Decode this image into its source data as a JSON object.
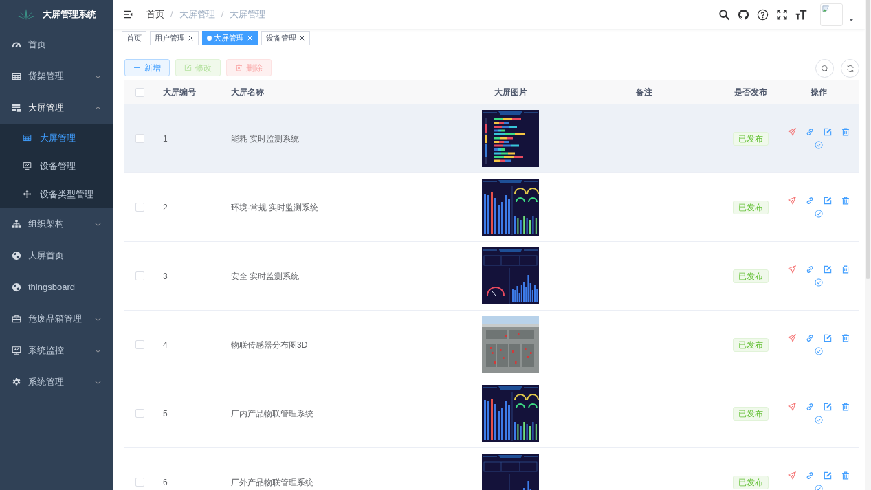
{
  "sidebar": {
    "title": "大屏管理系统",
    "items": [
      {
        "label": "首页",
        "kind": "link",
        "selected": false
      },
      {
        "label": "货架管理",
        "kind": "group",
        "selected": false,
        "expanded": false
      },
      {
        "label": "大屏管理",
        "kind": "group",
        "selected": true,
        "expanded": true,
        "children": [
          {
            "label": "大屏管理",
            "selected": true
          },
          {
            "label": "设备管理",
            "selected": false
          },
          {
            "label": "设备类型管理",
            "selected": false
          }
        ]
      },
      {
        "label": "组织架构",
        "kind": "group",
        "selected": false,
        "expanded": false
      },
      {
        "label": "大屏首页",
        "kind": "link",
        "selected": false
      },
      {
        "label": "thingsboard",
        "kind": "link",
        "selected": false
      },
      {
        "label": "危废品箱管理",
        "kind": "group",
        "selected": false,
        "expanded": false
      },
      {
        "label": "系统监控",
        "kind": "group",
        "selected": false,
        "expanded": false
      },
      {
        "label": "系统管理",
        "kind": "group",
        "selected": false,
        "expanded": false
      }
    ]
  },
  "navbar": {
    "breadcrumb": {
      "separator": "/",
      "items": [
        {
          "label": "首页",
          "kind": "link"
        },
        {
          "label": "大屏管理",
          "kind": "text"
        },
        {
          "label": "大屏管理",
          "kind": "text"
        }
      ]
    }
  },
  "tags": [
    {
      "label": "首页",
      "selected": false,
      "closable": false
    },
    {
      "label": "用户管理",
      "selected": false,
      "closable": true
    },
    {
      "label": "大屏管理",
      "selected": true,
      "closable": true
    },
    {
      "label": "设备管理",
      "selected": false,
      "closable": true
    }
  ],
  "toolbar": {
    "buttons": [
      {
        "label": "新增",
        "kind": "primary",
        "disabled": false
      },
      {
        "label": "修改",
        "kind": "success",
        "disabled": true
      },
      {
        "label": "删除",
        "kind": "danger",
        "disabled": true
      }
    ]
  },
  "table": {
    "all_checked": false,
    "columns": [
      "大屏编号",
      "大屏名称",
      "大屏图片",
      "备注",
      "是否发布",
      "操作"
    ],
    "rows": [
      {
        "id": "1",
        "name": "能耗 实时监测系统",
        "thumbnail": {
          "kind": "dashboard"
        },
        "status": "已发布",
        "checked": false,
        "hovered": true
      },
      {
        "id": "2",
        "name": "环境-常规 实时监测系统",
        "thumbnail": {
          "kind": "dashboard"
        },
        "status": "已发布",
        "checked": false,
        "hovered": false
      },
      {
        "id": "3",
        "name": "安全 实时监测系统",
        "thumbnail": {
          "kind": "dashboard"
        },
        "status": "已发布",
        "checked": false,
        "hovered": false
      },
      {
        "id": "4",
        "name": "物联传感器分布图3D",
        "thumbnail": {
          "kind": "map"
        },
        "status": "已发布",
        "checked": false,
        "hovered": false
      },
      {
        "id": "5",
        "name": "厂内产品物联管理系统",
        "thumbnail": {
          "kind": "dashboard"
        },
        "status": "已发布",
        "checked": false,
        "hovered": false
      },
      {
        "id": "6",
        "name": "厂外产品物联管理系统",
        "thumbnail": {
          "kind": "dashboard"
        },
        "status": "已发布",
        "checked": false,
        "hovered": false
      }
    ]
  }
}
